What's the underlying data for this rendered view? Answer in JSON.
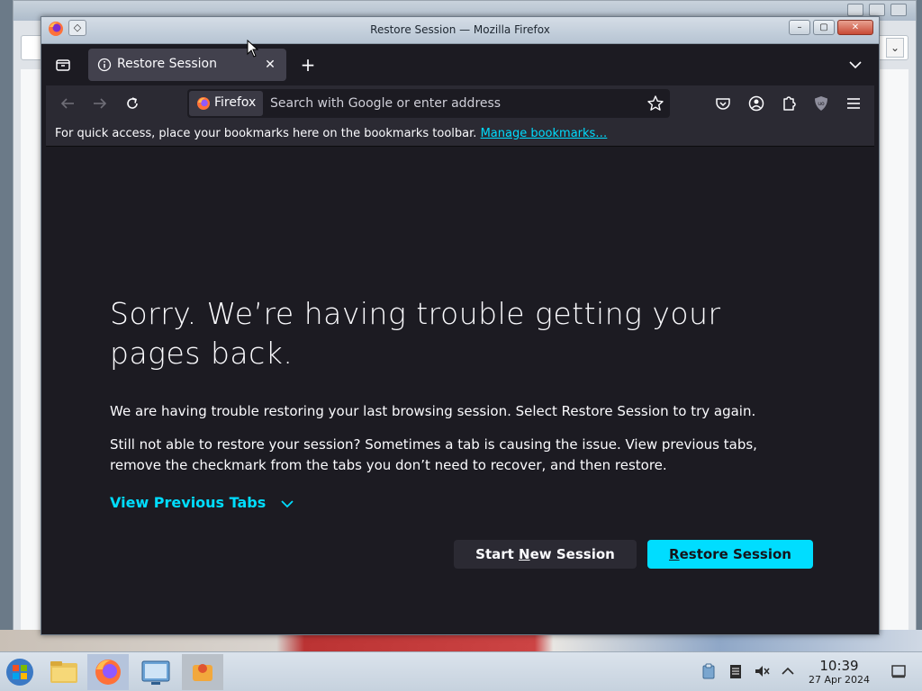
{
  "background_window": {
    "dropdown_glyph": "⌄"
  },
  "firefox_window": {
    "title": "Restore Session — Mozilla Firefox",
    "window_buttons": {
      "minimize": "–",
      "maximize": "▢",
      "close": "✕"
    },
    "pin_glyph": "◇"
  },
  "tabs": {
    "active_tab": {
      "label": "Restore Session",
      "icon": "info-icon",
      "close_glyph": "✕"
    },
    "new_tab_glyph": "+"
  },
  "navbar": {
    "identity_label": "Firefox",
    "url_placeholder": "Search with Google or enter address",
    "url_value": ""
  },
  "bookmarks_bar": {
    "message": "For quick access, place your bookmarks here on the bookmarks toolbar.",
    "link": "Manage bookmarks…"
  },
  "content": {
    "title": "Sorry. We’re having trouble getting your pages back.",
    "paragraph1": "We are having trouble restoring your last browsing session. Select Restore Session to try again.",
    "paragraph2": "Still not able to restore your session? Sometimes a tab is causing the issue. View previous tabs, remove the checkmark from the tabs you don’t need to recover, and then restore.",
    "view_previous_tabs": "View Previous Tabs",
    "start_new_session": {
      "before": "Start ",
      "accesskey": "N",
      "after": "ew Session"
    },
    "restore_session": {
      "before": "",
      "accesskey": "R",
      "after": "estore Session"
    }
  },
  "taskbar": {
    "time": "10:39",
    "date": "27 Apr 2024",
    "items": [
      "start-menu-icon",
      "file-manager-icon",
      "firefox-icon",
      "system-settings-icon",
      "app-launcher-icon"
    ],
    "tray": [
      "clipboard-icon",
      "notes-icon",
      "volume-muted-icon",
      "expand-tray-icon"
    ]
  },
  "colors": {
    "accent": "#00ddff",
    "page_bg": "#1c1b22",
    "toolbar_bg": "#2b2a33",
    "tab_active_bg": "#42414d"
  }
}
